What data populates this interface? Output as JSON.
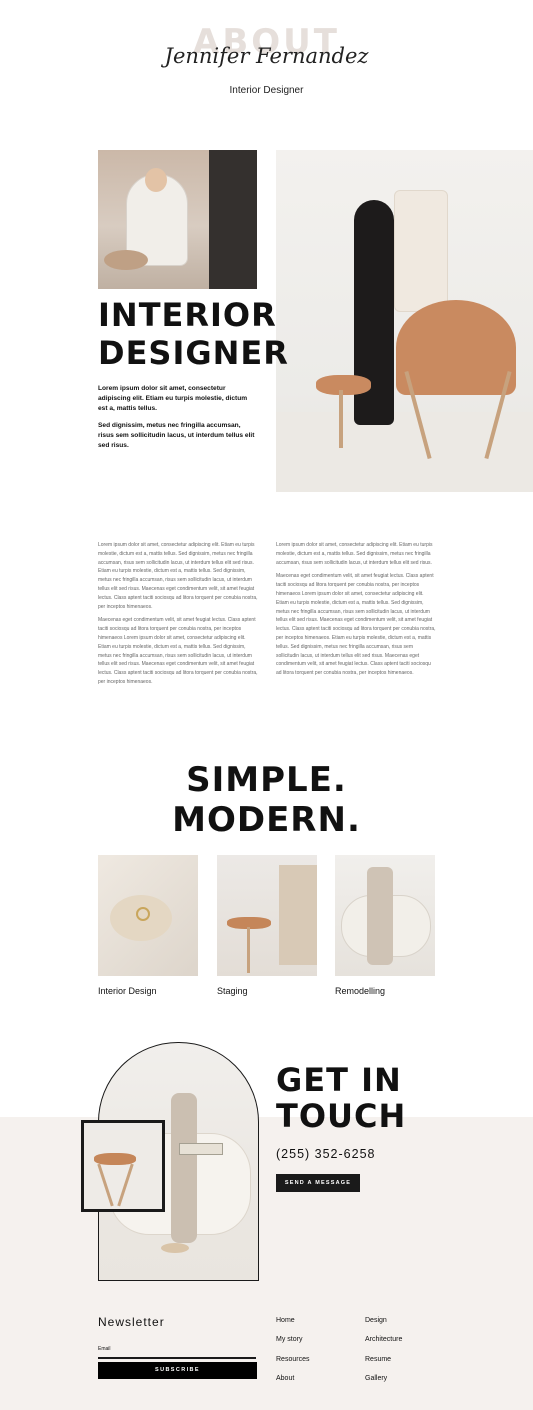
{
  "header": {
    "watermark": "ABOUT",
    "name": "Jennifer Fernandez",
    "subtitle": "Interior Designer"
  },
  "hero": {
    "title_line1": "INTERIOR",
    "title_line2": "DESIGNER",
    "para1": "Lorem ipsum dolor sit amet, consectetur adipiscing elit. Etiam eu turpis molestie, dictum est a, mattis tellus.",
    "para2": "Sed dignissim, metus nec fringilla accumsan, risus sem sollicitudin lacus, ut interdum tellus elit sed risus."
  },
  "body": {
    "left": [
      "Lorem ipsum dolor sit amet, consectetur adipiscing elit. Etiam eu turpis molestie, dictum est a, mattis tellus. Sed dignissim, metus nec fringilla accumsan, risus sem sollicitudin lacus, ut interdum tellus elit sed risus. Etiam eu turpis molestie, dictum est a, mattis tellus. Sed dignissim, metus nec fringilla accumsan, risus sem sollicitudin lacus, ut interdum tellus elit sed risus. Maecenas eget condimentum velit, sit amet feugiat lectus. Class aptent taciti sociosqu ad litora torquent per conubia nostra, per inceptos himenaeos.",
      "Maecenas eget condimentum velit, sit amet feugiat lectus. Class aptent taciti sociosqu ad litora torquent per conubia nostra, per inceptos himenaeos Lorem ipsum dolor sit amet, consectetur adipiscing elit. Etiam eu turpis molestie, dictum est a, mattis tellus. Sed dignissim, metus nec fringilla accumsan, risus sem sollicitudin lacus, ut interdum tellus elit sed risus. Maecenas eget condimentum velit, sit amet feugiat lectus. Class aptent taciti sociosqu ad litora torquent per conubia nostra, per inceptos himenaeos."
    ],
    "right": [
      "Lorem ipsum dolor sit amet, consectetur adipiscing elit. Etiam eu turpis molestie, dictum est a, mattis tellus. Sed dignissim, metus nec fringilla accumsan, risus sem sollicitudin lacus, ut interdum tellus elit sed risus.",
      "Maecenas eget condimentum velit, sit amet feugiat lectus. Class aptent taciti sociosqu ad litora torquent per conubia nostra, per inceptos himenaeos Lorem ipsum dolor sit amet, consectetur adipiscing elit. Etiam eu turpis molestie, dictum est a, mattis tellus. Sed dignissim, metus nec fringilla accumsan, risus sem sollicitudin lacus, ut interdum tellus elit sed risus. Maecenas eget condimentum velit, sit amet feugiat lectus. Class aptent taciti sociosqu ad litora torquent per conubia nostra, per inceptos himenaeos. Etiam eu turpis molestie, dictum est a, mattis tellus. Sed dignissim, metus nec fringilla accumsan, risus sem sollicitudin lacus, ut interdum tellus elit sed risus. Maecenas eget condimentum velit, sit amet feugiat lectus. Class aptent taciti sociosqu ad litora torquent per conubia nostra, per inceptos himenaeos."
    ]
  },
  "services": {
    "title_line1": "SIMPLE.",
    "title_line2": "MODERN.",
    "items": [
      {
        "label": "Interior Design"
      },
      {
        "label": "Staging"
      },
      {
        "label": "Remodelling"
      }
    ]
  },
  "contact": {
    "title_line1": "GET IN",
    "title_line2": "TOUCH",
    "phone": "(255) 352-6258",
    "button": "SEND A MESSAGE"
  },
  "newsletter": {
    "title": "Newsletter",
    "email_label": "Email",
    "email_placeholder": "",
    "button": "SUBSCRIBE"
  },
  "footer": {
    "col1": [
      "Home",
      "My story",
      "Resources",
      "About"
    ],
    "col2": [
      "Design",
      "Architecture",
      "Resume",
      "Gallery"
    ]
  },
  "colors": {
    "accent_dark": "#1a1a1a",
    "band_bg": "#f5f1ee",
    "watermark": "#e6dfdb"
  }
}
